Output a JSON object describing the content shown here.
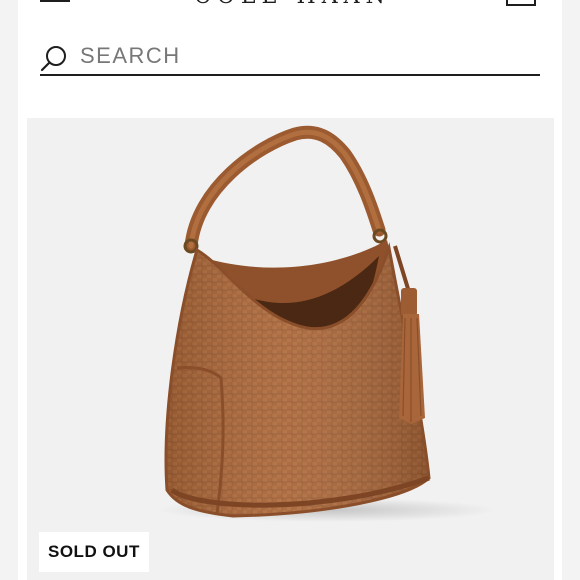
{
  "header": {
    "brand": "COLE HAAN",
    "menu_icon": "hamburger-menu-icon",
    "cart_icon": "shopping-bag-icon"
  },
  "search": {
    "placeholder": "SEARCH",
    "icon": "search-icon"
  },
  "product": {
    "status_badge": "SOLD OUT",
    "image_subject": "woven leather hobo shoulder bag with tassel",
    "colors": {
      "bag_base": "#b06d3f",
      "bag_shadow": "#8a4f2a",
      "bag_highlight": "#c98a58",
      "card_background": "#f1f1f1"
    }
  },
  "colors": {
    "text_primary": "#1e1e1e",
    "placeholder": "#777777",
    "page_background": "#ffffff",
    "frame_background": "#f3f3f4"
  }
}
